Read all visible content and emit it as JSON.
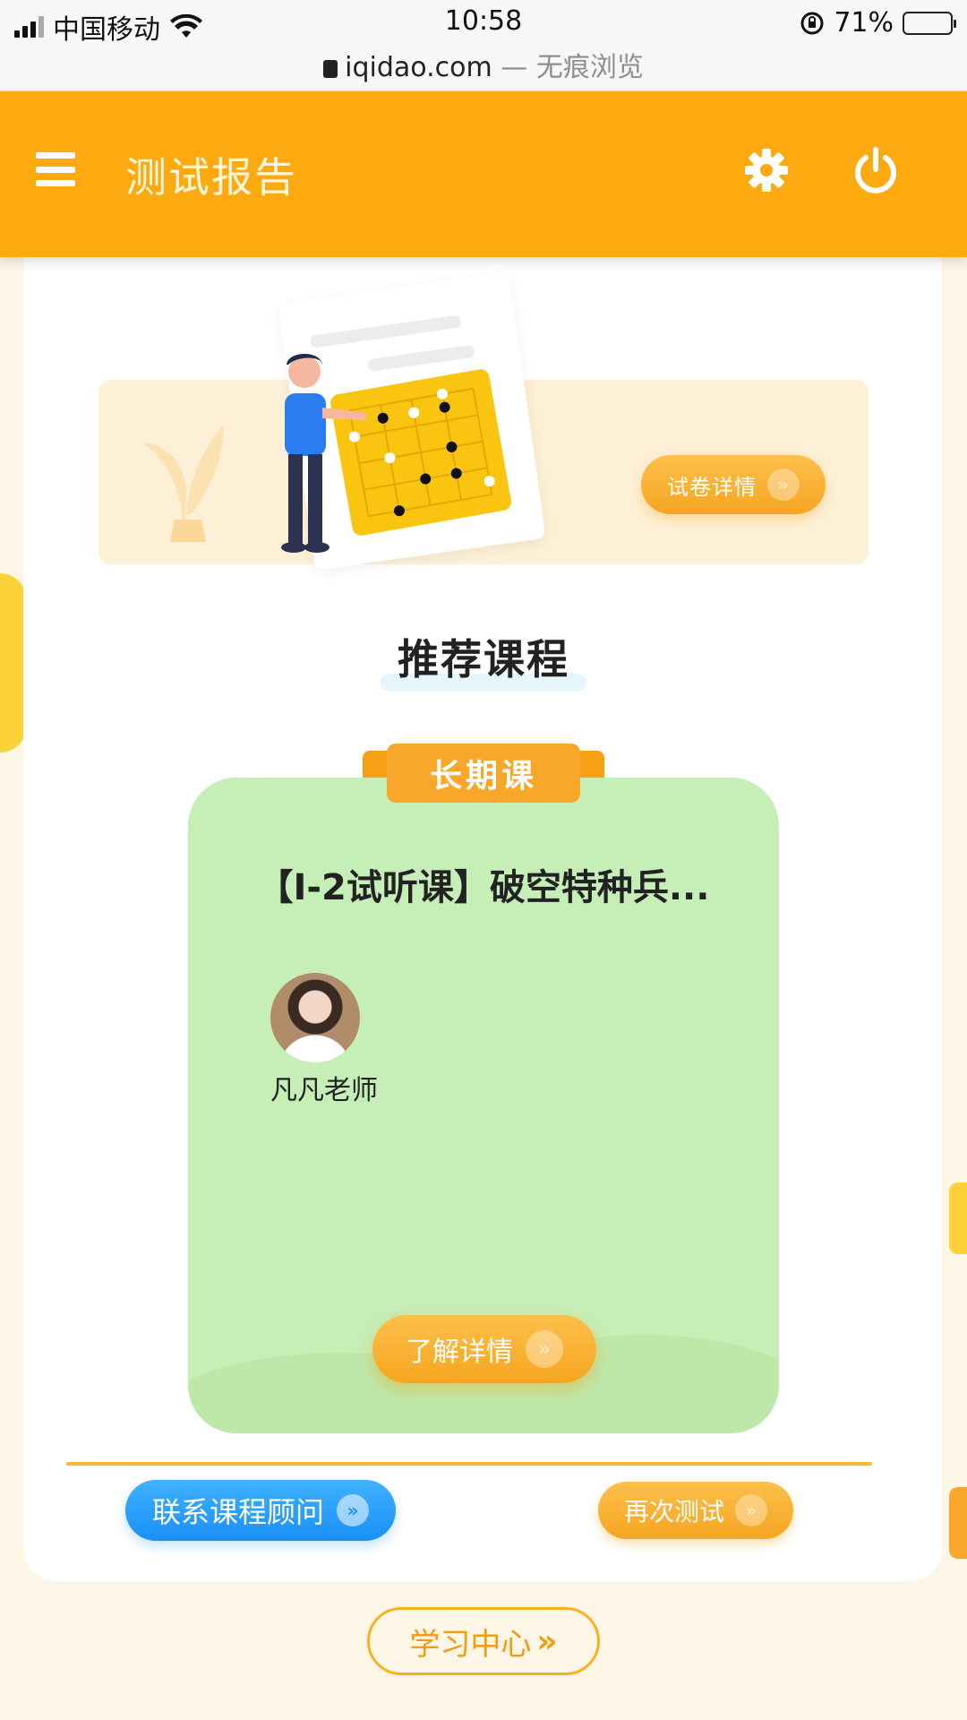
{
  "status_bar": {
    "carrier": "中国移动",
    "time": "10:58",
    "battery": "71%",
    "battery_level": 0.71
  },
  "browser": {
    "domain": "iqidao.com",
    "mode_separator": "—",
    "mode": "无痕浏览"
  },
  "header": {
    "title": "测试报告"
  },
  "banner": {
    "detail_button": "试卷详情"
  },
  "section": {
    "title": "推荐课程"
  },
  "course": {
    "ribbon": "长期课",
    "title": "【I-2试听课】破空特种兵...",
    "teacher": "凡凡老师",
    "learn_button": "了解详情"
  },
  "actions": {
    "contact": "联系课程顾问",
    "retest": "再次测试",
    "study_center": "学习中心"
  },
  "icons": {
    "chevron": "»"
  },
  "colors": {
    "header": "#fdaa10",
    "course_card": "#c6eeb7",
    "primary_orange": "#f6a520",
    "primary_blue": "#1a8ff5"
  }
}
